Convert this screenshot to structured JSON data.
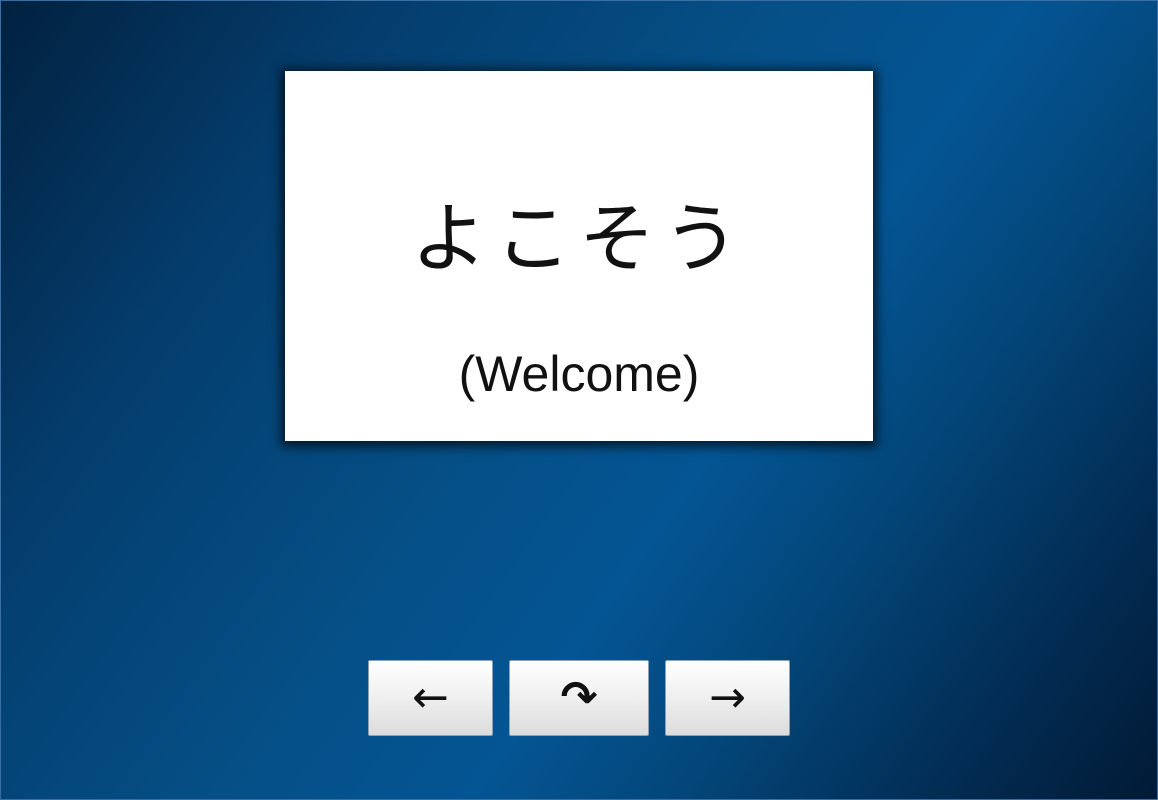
{
  "flashcard": {
    "word": "よこそう",
    "translation": "(Welcome)"
  },
  "controls": {
    "previous_symbol": "←",
    "flip_symbol": "↷",
    "next_symbol": "→"
  },
  "colors": {
    "background_mid": "#054f86",
    "background_dark": "#011a35",
    "card_background": "#ffffff",
    "text": "#111111"
  },
  "icons": {
    "previous": "arrow-left-icon",
    "flip": "rotate-clockwise-icon",
    "next": "arrow-right-icon"
  }
}
